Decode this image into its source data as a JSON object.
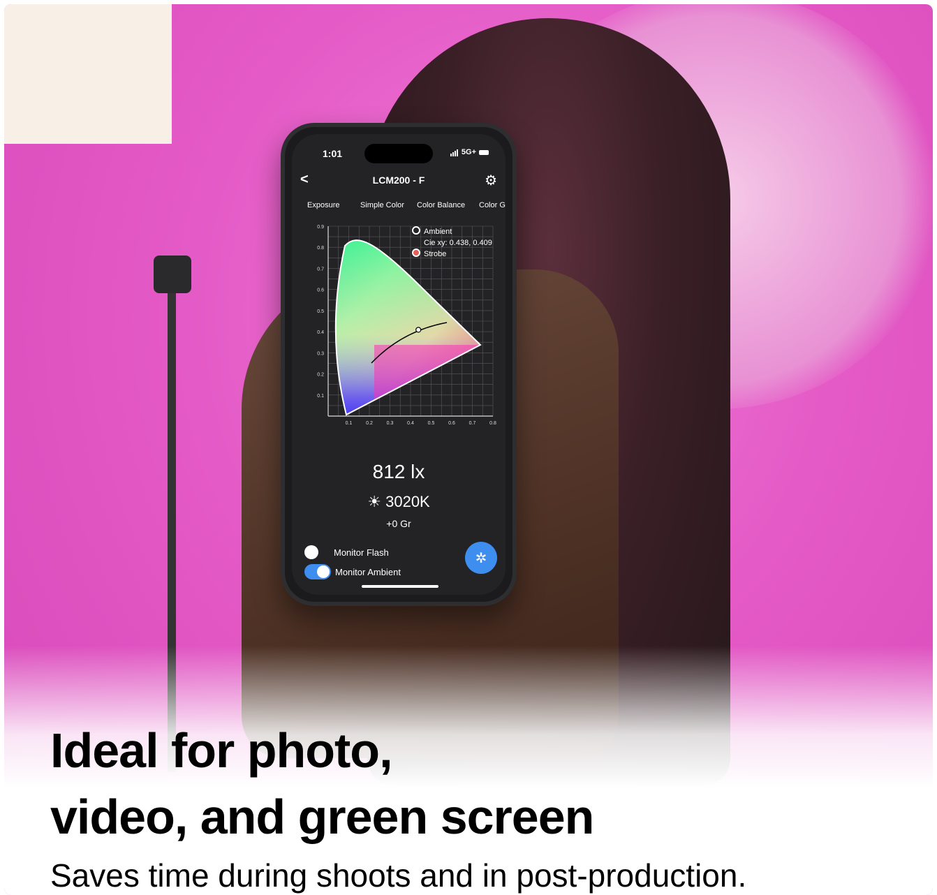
{
  "phone": {
    "status": {
      "time": "1:01",
      "network": "5G+"
    },
    "nav": {
      "back": "<",
      "title": "LCM200 - F",
      "settings_icon": "gear-icon"
    },
    "tabs": [
      "Exposure",
      "Simple Color",
      "Color Balance",
      "Color Gr"
    ],
    "chart": {
      "legend_ambient": "Ambient",
      "legend_cie": "Cie xy: 0.438, 0.409",
      "legend_strobe": "Strobe"
    },
    "readout": {
      "lux": "812 lx",
      "cct": "3020K",
      "tint": "+0 Gr"
    },
    "toggles": {
      "flash": "Monitor Flash",
      "ambient": "Monitor Ambient"
    },
    "fab_icon": "shutter-icon"
  },
  "chart_data": {
    "type": "scatter",
    "xlim": [
      0,
      0.8
    ],
    "ylim": [
      0,
      0.9
    ],
    "x_ticks": [
      "0.1",
      "0.2",
      "0.3",
      "0.4",
      "0.5",
      "0.6",
      "0.7",
      "0.8"
    ],
    "y_ticks": [
      "0.9",
      "0.8",
      "0.7",
      "0.6",
      "0.5",
      "0.4",
      "0.3",
      "0.2",
      "0.1"
    ],
    "points": [
      {
        "x": 0.438,
        "y": 0.409
      }
    ]
  },
  "headline": {
    "line1": "Ideal for photo,",
    "line2": "video, and green screen"
  },
  "subline": "Saves time during shoots and in post-production."
}
